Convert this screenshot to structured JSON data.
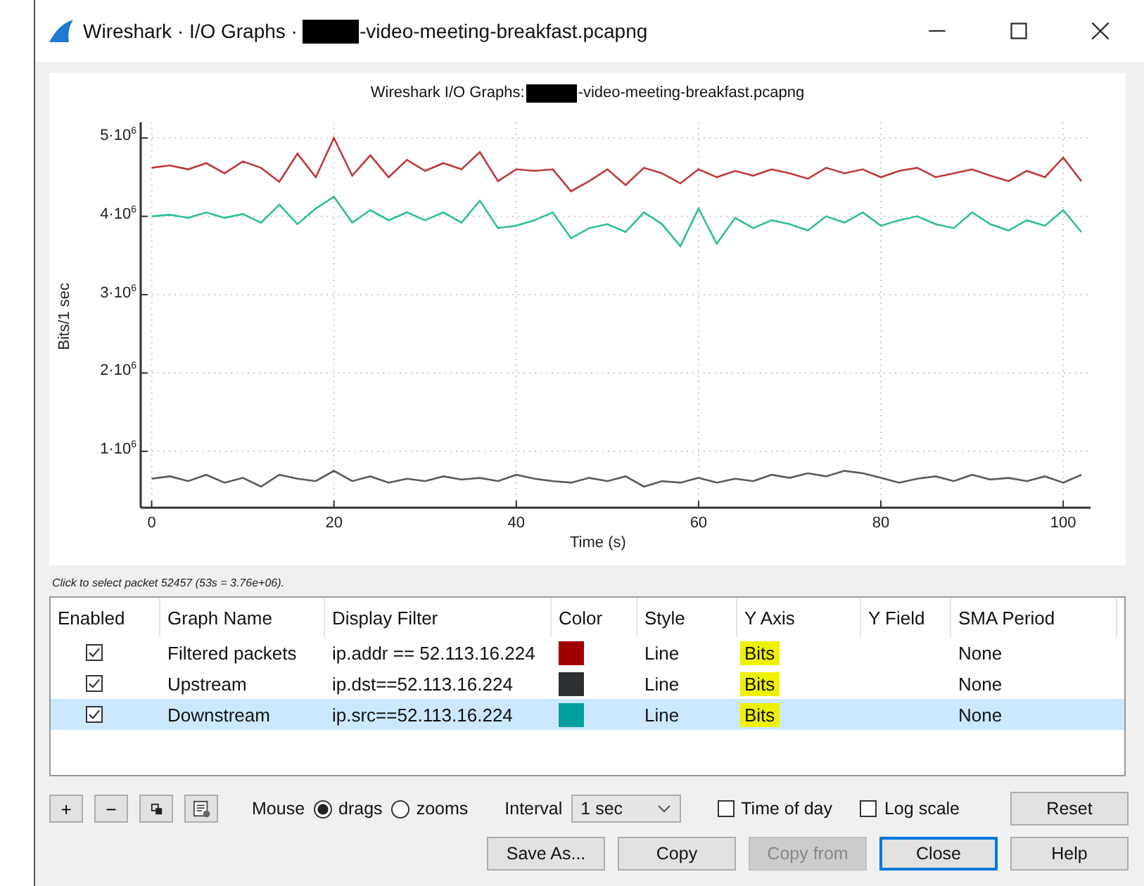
{
  "window": {
    "title_prefix": "Wireshark · I/O Graphs ·",
    "title_suffix": "-video-meeting-breakfast.pcapng"
  },
  "plot": {
    "title_prefix": "Wireshark I/O Graphs:",
    "title_suffix": "-video-meeting-breakfast.pcapng",
    "chart_data": {
      "type": "line",
      "xlabel": "Time (s)",
      "ylabel": "Bits/1 sec",
      "x": [
        0,
        2,
        4,
        6,
        8,
        10,
        12,
        14,
        16,
        18,
        20,
        22,
        24,
        26,
        28,
        30,
        32,
        34,
        36,
        38,
        40,
        42,
        44,
        46,
        48,
        50,
        52,
        54,
        56,
        58,
        60,
        62,
        64,
        66,
        68,
        70,
        72,
        74,
        76,
        78,
        80,
        82,
        84,
        86,
        88,
        90,
        92,
        94,
        96,
        98,
        100,
        102
      ],
      "series": [
        {
          "color": "#c0393b",
          "values": [
            4620000,
            4650000,
            4600000,
            4680000,
            4550000,
            4700000,
            4620000,
            4440000,
            4800000,
            4500000,
            5000000,
            4520000,
            4780000,
            4500000,
            4720000,
            4580000,
            4680000,
            4600000,
            4820000,
            4450000,
            4600000,
            4580000,
            4600000,
            4320000,
            4450000,
            4600000,
            4400000,
            4620000,
            4550000,
            4420000,
            4600000,
            4500000,
            4580000,
            4520000,
            4600000,
            4550000,
            4480000,
            4620000,
            4550000,
            4600000,
            4500000,
            4580000,
            4620000,
            4500000,
            4550000,
            4600000,
            4520000,
            4450000,
            4580000,
            4500000,
            4750000,
            4450000
          ]
        },
        {
          "color": "#5a5a5a",
          "values": [
            650000,
            680000,
            620000,
            700000,
            600000,
            660000,
            550000,
            700000,
            650000,
            620000,
            750000,
            620000,
            680000,
            600000,
            650000,
            620000,
            680000,
            640000,
            660000,
            620000,
            700000,
            650000,
            620000,
            600000,
            660000,
            620000,
            680000,
            550000,
            620000,
            600000,
            660000,
            600000,
            650000,
            620000,
            700000,
            660000,
            720000,
            680000,
            750000,
            720000,
            660000,
            600000,
            650000,
            680000,
            620000,
            700000,
            640000,
            660000,
            620000,
            680000,
            600000,
            700000
          ]
        },
        {
          "color": "#2ebf9a",
          "values": [
            4000000,
            4020000,
            3980000,
            4050000,
            3980000,
            4030000,
            3920000,
            4150000,
            3900000,
            4100000,
            4250000,
            3920000,
            4080000,
            3950000,
            4050000,
            3950000,
            4050000,
            3920000,
            4200000,
            3850000,
            3880000,
            3950000,
            4050000,
            3720000,
            3850000,
            3900000,
            3800000,
            4050000,
            3900000,
            3620000,
            4100000,
            3650000,
            3980000,
            3850000,
            3950000,
            3900000,
            3820000,
            4000000,
            3920000,
            4050000,
            3880000,
            3950000,
            4000000,
            3900000,
            3850000,
            4050000,
            3900000,
            3820000,
            3950000,
            3880000,
            4080000,
            3800000
          ]
        }
      ],
      "xlim": [
        -1.2,
        103
      ],
      "ylim": [
        280000,
        5200000
      ],
      "xticks": [
        0,
        20,
        40,
        60,
        80,
        100
      ],
      "yticks": [
        {
          "value": 1000000,
          "label": "1·10$^{6}$"
        },
        {
          "value": 2000000,
          "label": "2·10$^{6}$"
        },
        {
          "value": 3000000,
          "label": "3·10$^{6}$"
        },
        {
          "value": 4000000,
          "label": "4·10$^{6}$"
        },
        {
          "value": 5000000,
          "label": "5·10$^{6}$"
        }
      ],
      "grid": true
    }
  },
  "hint": "Click to select packet 52457 (53s = 3.76e+06).",
  "table": {
    "columns": [
      "Enabled",
      "Graph Name",
      "Display Filter",
      "Color",
      "Style",
      "Y Axis",
      "Y Field",
      "SMA Period"
    ],
    "rows": [
      {
        "enabled": true,
        "name": "Filtered packets",
        "filter": "ip.addr == 52.113.16.224",
        "color": "#a00000",
        "style": "Line",
        "y_axis": "Bits",
        "y_axis_highlighted": true,
        "sma_period": "None",
        "selected": false
      },
      {
        "enabled": true,
        "name": "Upstream",
        "filter": "ip.dst==52.113.16.224",
        "color": "#2d3033",
        "style": "Line",
        "y_axis": "Bits",
        "y_axis_highlighted": true,
        "sma_period": "None",
        "selected": false
      },
      {
        "enabled": true,
        "name": "Downstream",
        "filter": "ip.src==52.113.16.224",
        "color": "#009f9f",
        "style": "Line",
        "y_axis": "Bits",
        "y_axis_highlighted": true,
        "sma_period": "None",
        "selected": true
      }
    ]
  },
  "toolbar": {
    "tool_buttons": [
      {
        "kind": "add",
        "label": "+"
      },
      {
        "kind": "remove",
        "label": "−"
      },
      {
        "kind": "copy"
      },
      {
        "kind": "clear"
      }
    ],
    "mouse": {
      "label": "Mouse",
      "options": [
        {
          "label": "drags",
          "selected": true
        },
        {
          "label": "zooms",
          "selected": false
        }
      ]
    },
    "interval": {
      "label": "Interval",
      "value": "1 sec"
    },
    "checkboxes": [
      {
        "label": "Time of day",
        "checked": false
      },
      {
        "label": "Log scale",
        "checked": false
      }
    ],
    "reset": "Reset"
  },
  "buttons": [
    {
      "label": "Save As...",
      "disabled": false,
      "default": false
    },
    {
      "label": "Copy",
      "disabled": false,
      "default": false
    },
    {
      "label": "Copy from",
      "disabled": true,
      "default": false
    },
    {
      "label": "Close",
      "disabled": false,
      "default": true
    },
    {
      "label": "Help",
      "disabled": false,
      "default": false
    }
  ]
}
